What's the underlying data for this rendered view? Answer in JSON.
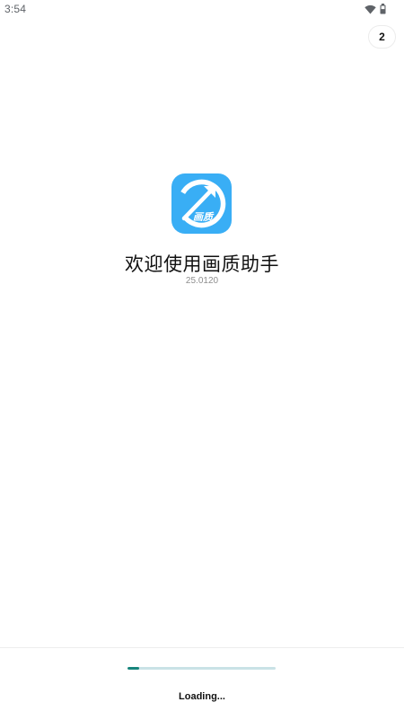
{
  "status_bar": {
    "time": "3:54",
    "wifi_icon": "wifi-icon",
    "battery_icon": "battery-icon"
  },
  "skip_badge": {
    "countdown": "2"
  },
  "splash": {
    "logo_icon": "app-logo-icon",
    "logo_text": "画质",
    "title": "欢迎使用画质助手",
    "version": "25.0120"
  },
  "footer": {
    "progress_fraction": 0.08,
    "loading_label": "Loading..."
  },
  "colors": {
    "logo_blue": "#39aef5",
    "progress_track": "#c9e2e6",
    "progress_fill": "#17857c"
  }
}
